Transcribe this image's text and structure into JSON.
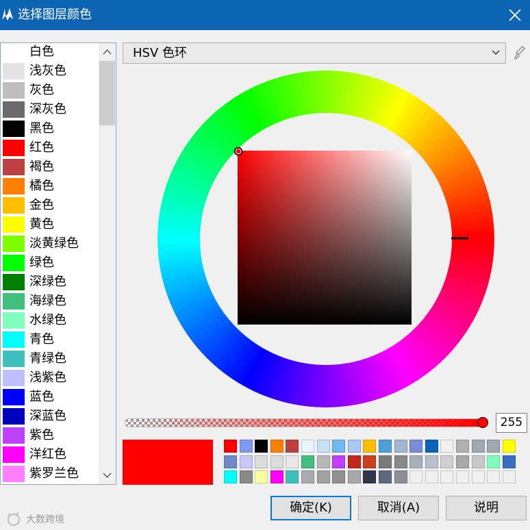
{
  "window": {
    "title": "选择图层颜色"
  },
  "color_list": [
    {
      "label": "白色",
      "color": "#ffffff"
    },
    {
      "label": "浅灰色",
      "color": "#e3e3e3"
    },
    {
      "label": "灰色",
      "color": "#bdbdbd"
    },
    {
      "label": "深灰色",
      "color": "#6b6b6b"
    },
    {
      "label": "黑色",
      "color": "#000000"
    },
    {
      "label": "红色",
      "color": "#ff0000"
    },
    {
      "label": "褐色",
      "color": "#bf4040"
    },
    {
      "label": "橘色",
      "color": "#ff8000"
    },
    {
      "label": "金色",
      "color": "#ffbf00"
    },
    {
      "label": "黄色",
      "color": "#ffff00"
    },
    {
      "label": "淡黄绿色",
      "color": "#80ff00"
    },
    {
      "label": "绿色",
      "color": "#00ff00"
    },
    {
      "label": "深绿色",
      "color": "#008000"
    },
    {
      "label": "海绿色",
      "color": "#40bf80"
    },
    {
      "label": "水绿色",
      "color": "#80ffbf"
    },
    {
      "label": "青色",
      "color": "#00ffff"
    },
    {
      "label": "青绿色",
      "color": "#40bfbf"
    },
    {
      "label": "浅紫色",
      "color": "#bfbfff"
    },
    {
      "label": "蓝色",
      "color": "#0000ff"
    },
    {
      "label": "深蓝色",
      "color": "#0000bf"
    },
    {
      "label": "紫色",
      "color": "#bf40ff"
    },
    {
      "label": "洋红色",
      "color": "#ff00ff"
    },
    {
      "label": "紫罗兰色",
      "color": "#ff80ff"
    }
  ],
  "picker": {
    "mode_label": "HSV 色环",
    "alpha_value": "255",
    "current_color": "#ff0000"
  },
  "palette": {
    "row1": [
      "#ff0000",
      "#7f9bf0",
      "#000000",
      "#ff8000",
      "#bf4040",
      "#ebf3fc",
      "#c7e0f4",
      "#70b8f0",
      "#a8c8f0",
      "#ffbf00",
      "#4ea0d8",
      "#a0b8d0",
      "#7a8ad8",
      "#0e64b4",
      "#f0f0f0",
      "#b0b0b0",
      "#a0a8b0",
      "#a0a8b0",
      "#ffff00"
    ],
    "row2": [
      "#7088c8",
      "#c8c8ff",
      "#dcdcdc",
      "#dcdcdc",
      "#e8e8e8",
      "#40bf80",
      "#b8b8b8",
      "#bf40ff",
      "#c0281c",
      "#c8401c",
      "#7a7a7a",
      "#888888",
      "#a8b0b8",
      "#b8c0d0",
      "#d0d0d0",
      "#a8a8a8",
      "#c8c8c8",
      "#80ffbf",
      "#3a6ec0"
    ],
    "row3": [
      "#00ffff",
      "#8a8a8a",
      "#ffffa0",
      "#ff00ff",
      "#40bfbf",
      "#a8acb0",
      "#a0a0a0",
      "#909090",
      "#a8a8a8",
      "#303848",
      "#5a6a80",
      "#8a9098",
      "#f0f0f0",
      "#f0f0f0",
      "#f0f0f0",
      "#f0f0f0",
      "#f0f0f0",
      "#f0f0f0",
      "#f0f0f0"
    ]
  },
  "buttons": {
    "ok": "确定(K)",
    "cancel": "取消(A)",
    "help": "说明"
  },
  "watermark": {
    "text": "大数跨境"
  }
}
